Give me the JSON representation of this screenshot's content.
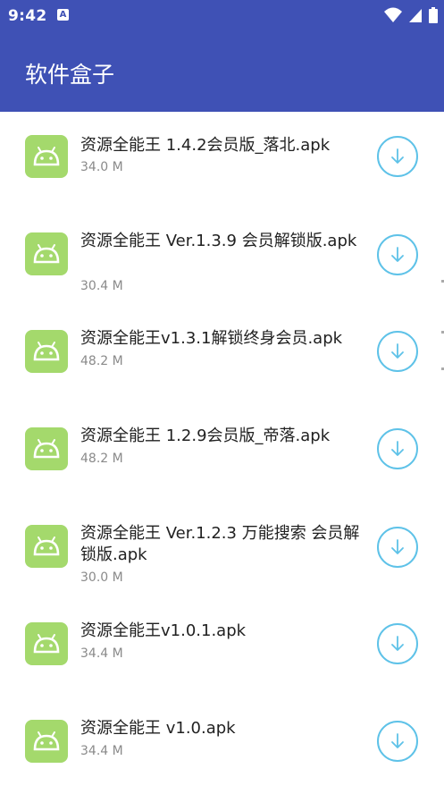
{
  "status_bar": {
    "time": "9:42",
    "notification_icon": "a-icon",
    "notification_letter": "A",
    "icons": [
      "wifi-icon",
      "signal-icon",
      "battery-icon"
    ]
  },
  "app_bar": {
    "title": "软件盒子"
  },
  "colors": {
    "primary": "#3f51b5",
    "app_icon_bg": "#a4d96c",
    "download_ring": "#5ec2e8"
  },
  "files": [
    {
      "name": "资源全能王 1.4.2会员版_落北.apk",
      "size": "34.0 M"
    },
    {
      "name": "资源全能王 Ver.1.3.9 会员解锁版.apk",
      "size": "30.4 M"
    },
    {
      "name": "资源全能王v1.3.1解锁终身会员.apk",
      "size": "48.2 M"
    },
    {
      "name": "资源全能王 1.2.9会员版_帝落.apk",
      "size": "48.2 M"
    },
    {
      "name": "资源全能王 Ver.1.2.3 万能搜索 会员解锁版.apk",
      "size": "30.0 M"
    },
    {
      "name": "资源全能王v1.0.1.apk",
      "size": "34.4 M"
    },
    {
      "name": "资源全能王 v1.0.apk",
      "size": "34.4 M"
    }
  ]
}
